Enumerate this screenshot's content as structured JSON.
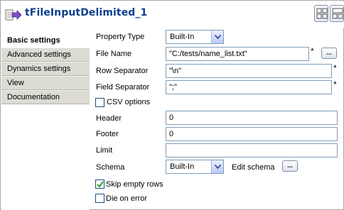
{
  "header": {
    "title": "tFileInputDelimited_1",
    "title_color": "#0c3f8d"
  },
  "sidebar": {
    "items": [
      {
        "label": "Basic settings",
        "active": true
      },
      {
        "label": "Advanced settings",
        "active": false
      },
      {
        "label": "Dynamics settings",
        "active": false
      },
      {
        "label": "View",
        "active": false
      },
      {
        "label": "Documentation",
        "active": false
      }
    ]
  },
  "form": {
    "property_type": {
      "label": "Property Type",
      "value": "Built-In"
    },
    "file_name": {
      "label": "File Name",
      "value": "\"C:/tests/name_list.txt\"",
      "required": "*",
      "browse": "..."
    },
    "row_separator": {
      "label": "Row Separator",
      "value": "\"\\n\"",
      "required": "*"
    },
    "field_separator": {
      "label": "Field Separator",
      "value": "\";\"",
      "required": "*"
    },
    "csv_options": {
      "label": "CSV options",
      "checked": false
    },
    "header": {
      "label": "Header",
      "value": "0"
    },
    "footer": {
      "label": "Footer",
      "value": "0"
    },
    "limit": {
      "label": "Limit",
      "value": ""
    },
    "schema": {
      "label": "Schema",
      "value": "Built-In",
      "edit_label": "Edit schema",
      "edit_button": "..."
    },
    "skip_empty_rows": {
      "label": "Skip empty rows",
      "checked": true
    },
    "die_on_error": {
      "label": "Die on error",
      "checked": false
    }
  },
  "icons": {
    "title_icon": "file-input-icon",
    "view_one": "layout-grid-icon",
    "view_two": "layout-split-icon"
  }
}
